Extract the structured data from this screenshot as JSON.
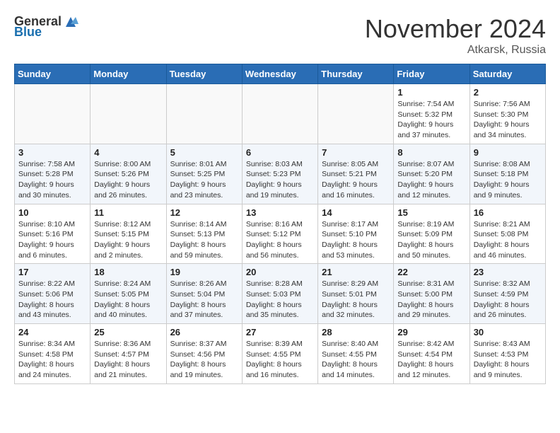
{
  "header": {
    "logo_general": "General",
    "logo_blue": "Blue",
    "month": "November 2024",
    "location": "Atkarsk, Russia"
  },
  "weekdays": [
    "Sunday",
    "Monday",
    "Tuesday",
    "Wednesday",
    "Thursday",
    "Friday",
    "Saturday"
  ],
  "weeks": [
    [
      {
        "day": "",
        "info": ""
      },
      {
        "day": "",
        "info": ""
      },
      {
        "day": "",
        "info": ""
      },
      {
        "day": "",
        "info": ""
      },
      {
        "day": "",
        "info": ""
      },
      {
        "day": "1",
        "info": "Sunrise: 7:54 AM\nSunset: 5:32 PM\nDaylight: 9 hours and 37 minutes."
      },
      {
        "day": "2",
        "info": "Sunrise: 7:56 AM\nSunset: 5:30 PM\nDaylight: 9 hours and 34 minutes."
      }
    ],
    [
      {
        "day": "3",
        "info": "Sunrise: 7:58 AM\nSunset: 5:28 PM\nDaylight: 9 hours and 30 minutes."
      },
      {
        "day": "4",
        "info": "Sunrise: 8:00 AM\nSunset: 5:26 PM\nDaylight: 9 hours and 26 minutes."
      },
      {
        "day": "5",
        "info": "Sunrise: 8:01 AM\nSunset: 5:25 PM\nDaylight: 9 hours and 23 minutes."
      },
      {
        "day": "6",
        "info": "Sunrise: 8:03 AM\nSunset: 5:23 PM\nDaylight: 9 hours and 19 minutes."
      },
      {
        "day": "7",
        "info": "Sunrise: 8:05 AM\nSunset: 5:21 PM\nDaylight: 9 hours and 16 minutes."
      },
      {
        "day": "8",
        "info": "Sunrise: 8:07 AM\nSunset: 5:20 PM\nDaylight: 9 hours and 12 minutes."
      },
      {
        "day": "9",
        "info": "Sunrise: 8:08 AM\nSunset: 5:18 PM\nDaylight: 9 hours and 9 minutes."
      }
    ],
    [
      {
        "day": "10",
        "info": "Sunrise: 8:10 AM\nSunset: 5:16 PM\nDaylight: 9 hours and 6 minutes."
      },
      {
        "day": "11",
        "info": "Sunrise: 8:12 AM\nSunset: 5:15 PM\nDaylight: 9 hours and 2 minutes."
      },
      {
        "day": "12",
        "info": "Sunrise: 8:14 AM\nSunset: 5:13 PM\nDaylight: 8 hours and 59 minutes."
      },
      {
        "day": "13",
        "info": "Sunrise: 8:16 AM\nSunset: 5:12 PM\nDaylight: 8 hours and 56 minutes."
      },
      {
        "day": "14",
        "info": "Sunrise: 8:17 AM\nSunset: 5:10 PM\nDaylight: 8 hours and 53 minutes."
      },
      {
        "day": "15",
        "info": "Sunrise: 8:19 AM\nSunset: 5:09 PM\nDaylight: 8 hours and 50 minutes."
      },
      {
        "day": "16",
        "info": "Sunrise: 8:21 AM\nSunset: 5:08 PM\nDaylight: 8 hours and 46 minutes."
      }
    ],
    [
      {
        "day": "17",
        "info": "Sunrise: 8:22 AM\nSunset: 5:06 PM\nDaylight: 8 hours and 43 minutes."
      },
      {
        "day": "18",
        "info": "Sunrise: 8:24 AM\nSunset: 5:05 PM\nDaylight: 8 hours and 40 minutes."
      },
      {
        "day": "19",
        "info": "Sunrise: 8:26 AM\nSunset: 5:04 PM\nDaylight: 8 hours and 37 minutes."
      },
      {
        "day": "20",
        "info": "Sunrise: 8:28 AM\nSunset: 5:03 PM\nDaylight: 8 hours and 35 minutes."
      },
      {
        "day": "21",
        "info": "Sunrise: 8:29 AM\nSunset: 5:01 PM\nDaylight: 8 hours and 32 minutes."
      },
      {
        "day": "22",
        "info": "Sunrise: 8:31 AM\nSunset: 5:00 PM\nDaylight: 8 hours and 29 minutes."
      },
      {
        "day": "23",
        "info": "Sunrise: 8:32 AM\nSunset: 4:59 PM\nDaylight: 8 hours and 26 minutes."
      }
    ],
    [
      {
        "day": "24",
        "info": "Sunrise: 8:34 AM\nSunset: 4:58 PM\nDaylight: 8 hours and 24 minutes."
      },
      {
        "day": "25",
        "info": "Sunrise: 8:36 AM\nSunset: 4:57 PM\nDaylight: 8 hours and 21 minutes."
      },
      {
        "day": "26",
        "info": "Sunrise: 8:37 AM\nSunset: 4:56 PM\nDaylight: 8 hours and 19 minutes."
      },
      {
        "day": "27",
        "info": "Sunrise: 8:39 AM\nSunset: 4:55 PM\nDaylight: 8 hours and 16 minutes."
      },
      {
        "day": "28",
        "info": "Sunrise: 8:40 AM\nSunset: 4:55 PM\nDaylight: 8 hours and 14 minutes."
      },
      {
        "day": "29",
        "info": "Sunrise: 8:42 AM\nSunset: 4:54 PM\nDaylight: 8 hours and 12 minutes."
      },
      {
        "day": "30",
        "info": "Sunrise: 8:43 AM\nSunset: 4:53 PM\nDaylight: 8 hours and 9 minutes."
      }
    ]
  ]
}
